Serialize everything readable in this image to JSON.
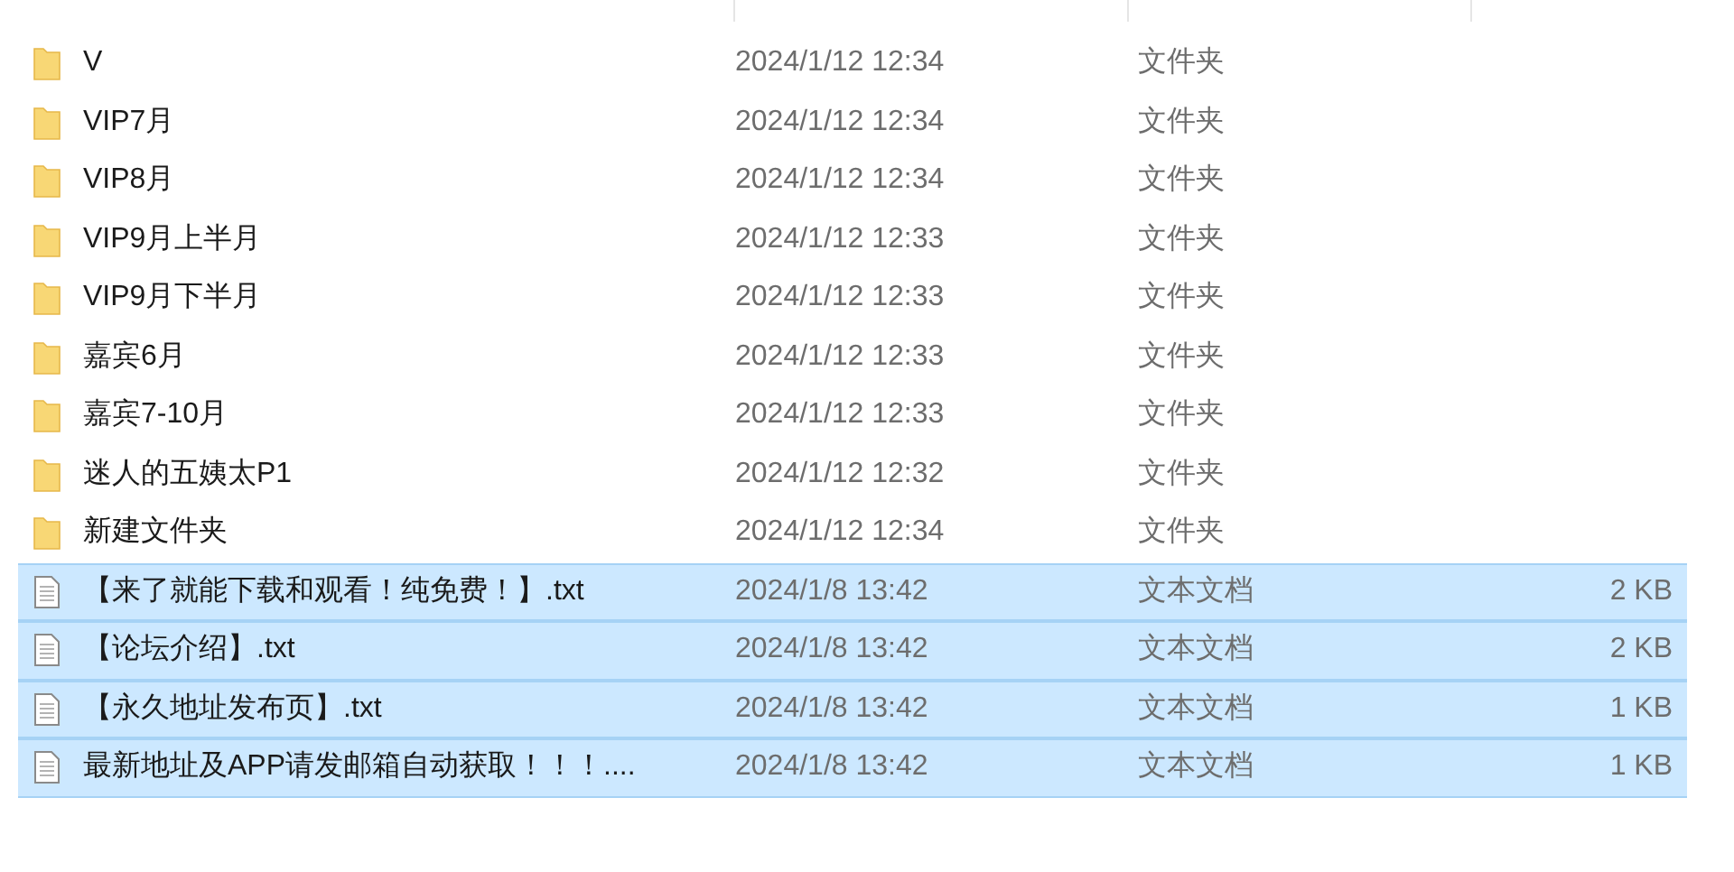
{
  "files": [
    {
      "kind": "folder",
      "name": "V",
      "date": "2024/1/12 12:34",
      "type": "文件夹",
      "selected": false
    },
    {
      "kind": "folder",
      "name": "VIP7月",
      "date": "2024/1/12 12:34",
      "type": "文件夹",
      "selected": false
    },
    {
      "kind": "folder",
      "name": "VIP8月",
      "date": "2024/1/12 12:34",
      "type": "文件夹",
      "selected": false
    },
    {
      "kind": "folder",
      "name": "VIP9月上半月",
      "date": "2024/1/12 12:33",
      "type": "文件夹",
      "selected": false
    },
    {
      "kind": "folder",
      "name": "VIP9月下半月",
      "date": "2024/1/12 12:33",
      "type": "文件夹",
      "selected": false
    },
    {
      "kind": "folder",
      "name": "嘉宾6月",
      "date": "2024/1/12 12:33",
      "type": "文件夹",
      "selected": false
    },
    {
      "kind": "folder",
      "name": "嘉宾7-10月",
      "date": "2024/1/12 12:33",
      "type": "文件夹",
      "selected": false
    },
    {
      "kind": "folder",
      "name": "迷人的五姨太P1",
      "date": "2024/1/12 12:32",
      "type": "文件夹",
      "selected": false
    },
    {
      "kind": "folder",
      "name": "新建文件夹",
      "date": "2024/1/12 12:34",
      "type": "文件夹",
      "selected": false
    },
    {
      "kind": "file",
      "name": "【来了就能下载和观看！纯免费！】.txt",
      "date": "2024/1/8 13:42",
      "type": "文本文档",
      "size": "2 KB",
      "selected": true
    },
    {
      "kind": "file",
      "name": "【论坛介绍】.txt",
      "date": "2024/1/8 13:42",
      "type": "文本文档",
      "size": "2 KB",
      "selected": true
    },
    {
      "kind": "file",
      "name": "【永久地址发布页】.txt",
      "date": "2024/1/8 13:42",
      "type": "文本文档",
      "size": "1 KB",
      "selected": true
    },
    {
      "kind": "file",
      "name": "最新地址及APP请发邮箱自动获取！！！....",
      "date": "2024/1/8 13:42",
      "type": "文本文档",
      "size": "1 KB",
      "selected": true
    }
  ]
}
